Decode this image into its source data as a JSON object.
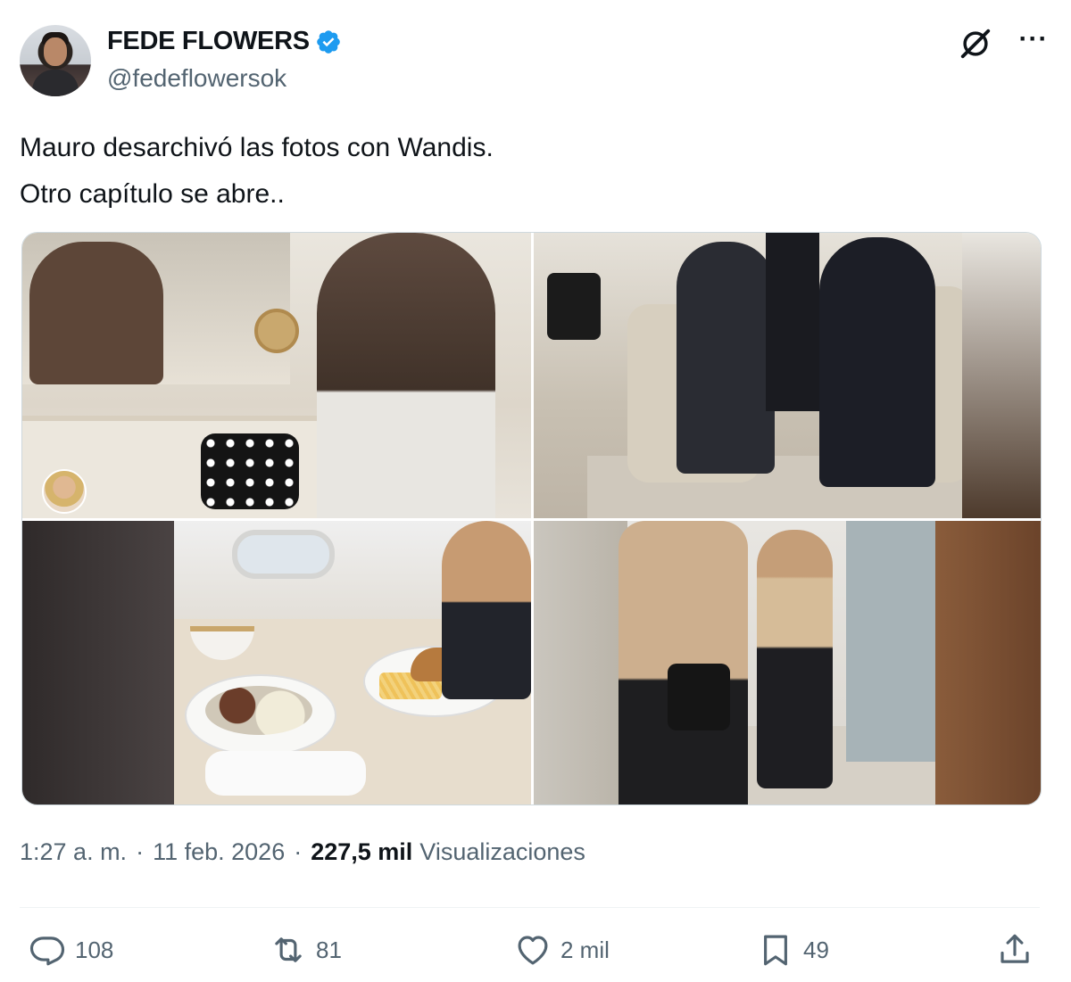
{
  "author": {
    "display_name": "FEDE FLOWERS",
    "handle": "@fedeflowersok",
    "verified": true,
    "accent_color": "#1d9bf0"
  },
  "tweet": {
    "lines": [
      "Mauro desarchivó las fotos con Wandis.",
      "Otro capítulo se abre.."
    ]
  },
  "media": {
    "count": 4,
    "photos": [
      "bathroom-photo",
      "jet-cabin-photo",
      "meal-photo",
      "cabin-door-photo"
    ]
  },
  "meta": {
    "time": "1:27 a. m.",
    "separator": "·",
    "date": "11 feb. 2026",
    "views_count": "227,5 mil",
    "views_label": "Visualizaciones"
  },
  "actions": {
    "replies": "108",
    "reposts": "81",
    "likes": "2 mil",
    "bookmarks": "49"
  },
  "icons": {
    "verified": "verified-badge-icon",
    "grok": "grok-icon",
    "more": "more-icon",
    "reply": "reply-icon",
    "repost": "repost-icon",
    "like": "heart-icon",
    "bookmark": "bookmark-icon",
    "share": "share-icon"
  }
}
